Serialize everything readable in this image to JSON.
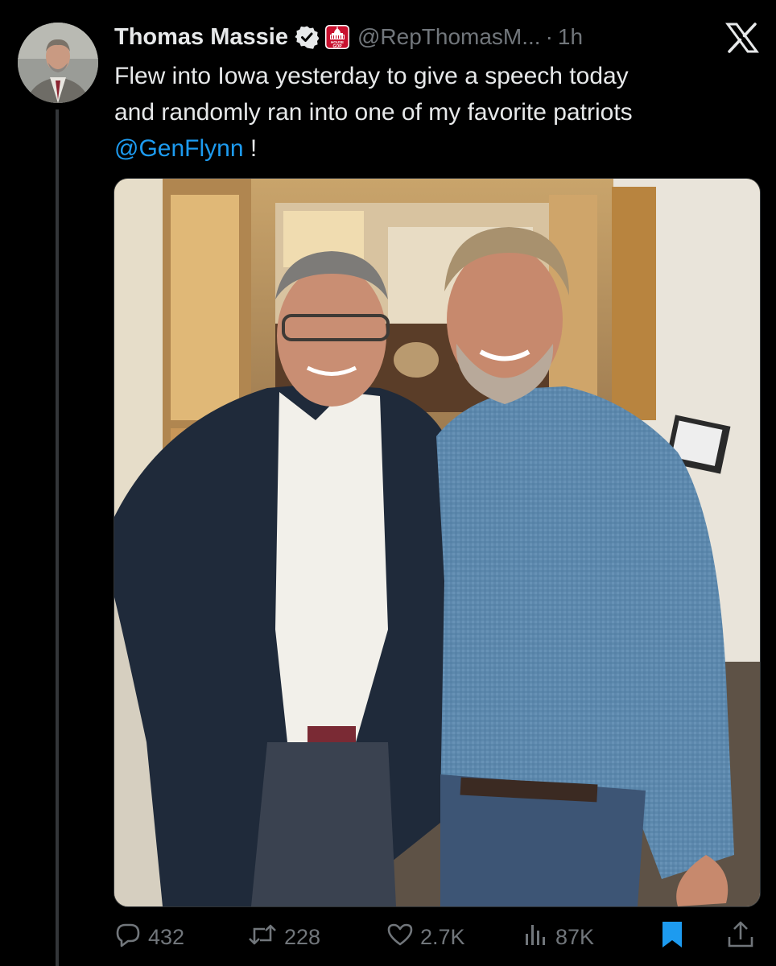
{
  "author": {
    "name": "Thomas Massie",
    "handle": "@RepThomasM...",
    "time": "1h",
    "separator": "·"
  },
  "tweet": {
    "text_line1": "Flew into Iowa yesterday to give a speech today",
    "text_line2": "and randomly ran into one of my favorite patriots",
    "mention": "@GenFlynn",
    "text_end": " !"
  },
  "affiliation_badge": {
    "label": "HOUSE GOP"
  },
  "stats": {
    "replies": "432",
    "reposts": "228",
    "likes": "2.7K",
    "views": "87K"
  },
  "icons": {
    "verified": "verified-badge-icon",
    "affiliation": "house-gop-capitol-icon",
    "close": "x-close-icon",
    "reply": "reply-bubble-icon",
    "repost": "repost-icon",
    "like": "heart-icon",
    "views": "views-bars-icon",
    "bookmark": "bookmark-icon",
    "share": "share-icon"
  },
  "colors": {
    "background": "#000000",
    "text": "#e7e9ea",
    "muted": "#71767b",
    "accent": "#1d9bf0",
    "affiliation_red": "#c8102e"
  }
}
